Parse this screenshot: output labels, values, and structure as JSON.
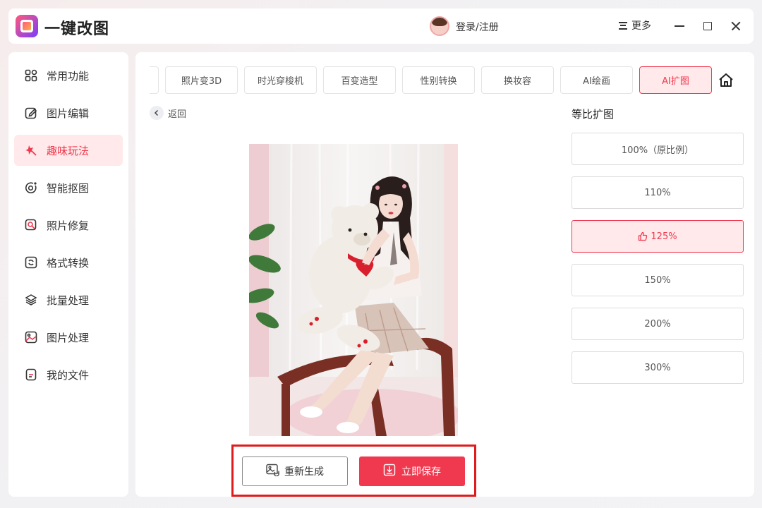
{
  "app": {
    "title": "一键改图",
    "login_label": "登录/注册",
    "more_label": "更多"
  },
  "sidebar": {
    "items": [
      {
        "label": "常用功能",
        "icon": "grid-icon"
      },
      {
        "label": "图片编辑",
        "icon": "edit-icon"
      },
      {
        "label": "趣味玩法",
        "icon": "magic-icon",
        "active": true
      },
      {
        "label": "智能抠图",
        "icon": "target-icon"
      },
      {
        "label": "照片修复",
        "icon": "repair-icon"
      },
      {
        "label": "格式转换",
        "icon": "convert-icon"
      },
      {
        "label": "批量处理",
        "icon": "layers-icon"
      },
      {
        "label": "图片处理",
        "icon": "image-icon"
      },
      {
        "label": "我的文件",
        "icon": "file-icon"
      }
    ]
  },
  "tabs": [
    "照片变3D",
    "时光穿梭机",
    "百变造型",
    "性别转换",
    "换妆容",
    "AI绘画",
    "AI扩图"
  ],
  "active_tab": "AI扩图",
  "back_label": "返回",
  "ratio_panel": {
    "title": "等比扩图",
    "options": [
      "100%（原比例）",
      "110%",
      "125%",
      "150%",
      "200%",
      "300%"
    ],
    "selected": "125%"
  },
  "actions": {
    "regenerate_label": "重新生成",
    "save_label": "立即保存"
  },
  "colors": {
    "accent": "#f0394f",
    "accent_light": "#ffe9ea",
    "highlight_box": "#e01b1b"
  }
}
